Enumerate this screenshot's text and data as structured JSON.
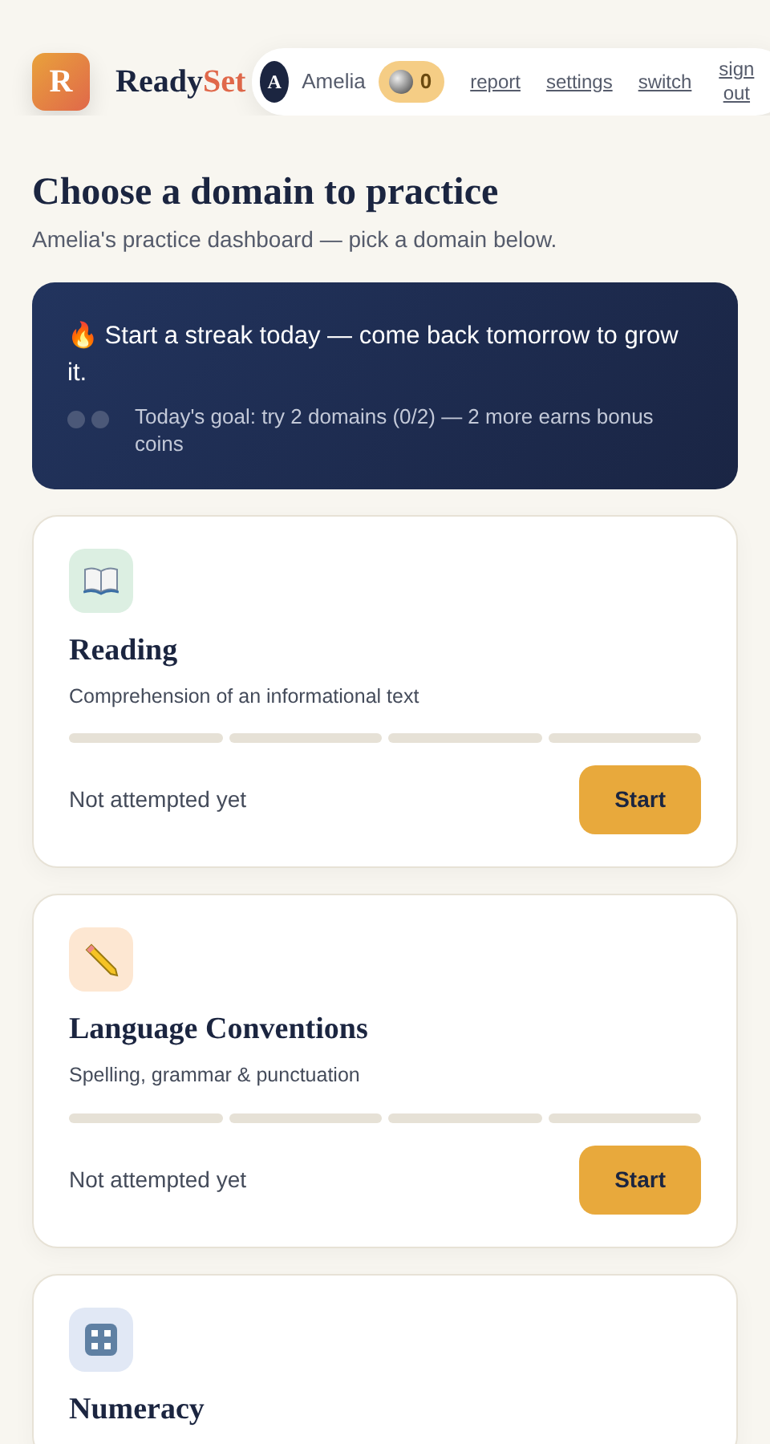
{
  "brand": {
    "logo_letter": "R",
    "name": "Ready",
    "name_accent": "Set"
  },
  "user": {
    "avatar_letter": "A",
    "name": "Amelia",
    "coins": "0"
  },
  "nav_links": [
    {
      "label": "report"
    },
    {
      "label": "settings"
    },
    {
      "label": "switch"
    },
    {
      "label": "sign out"
    }
  ],
  "heading": "Choose a domain to practice",
  "subheading": "Amelia's practice dashboard — pick a domain below.",
  "streak": {
    "icon": "🔥",
    "message": "Start a streak today — come back tomorrow to grow it.",
    "goal_dots": [
      {
        "done": false
      },
      {
        "done": false
      }
    ],
    "goal_text": "Today's goal: try 2 domains (0/2) — 2 more earns bonus coins"
  },
  "domains": [
    {
      "kind": "book",
      "title": "Reading",
      "description": "Comprehension of an informational text",
      "segments": [
        {
          "filled": false
        },
        {
          "filled": false
        },
        {
          "filled": false
        },
        {
          "filled": false
        }
      ],
      "status": "Not attempted yet",
      "button": "Start"
    },
    {
      "kind": "pencil",
      "title": "Language Conventions",
      "description": "Spelling, grammar & punctuation",
      "segments": [
        {
          "filled": false
        },
        {
          "filled": false
        },
        {
          "filled": false
        },
        {
          "filled": false
        }
      ],
      "status": "Not attempted yet",
      "button": "Start"
    },
    {
      "kind": "numbers",
      "title": "Numeracy"
    }
  ]
}
